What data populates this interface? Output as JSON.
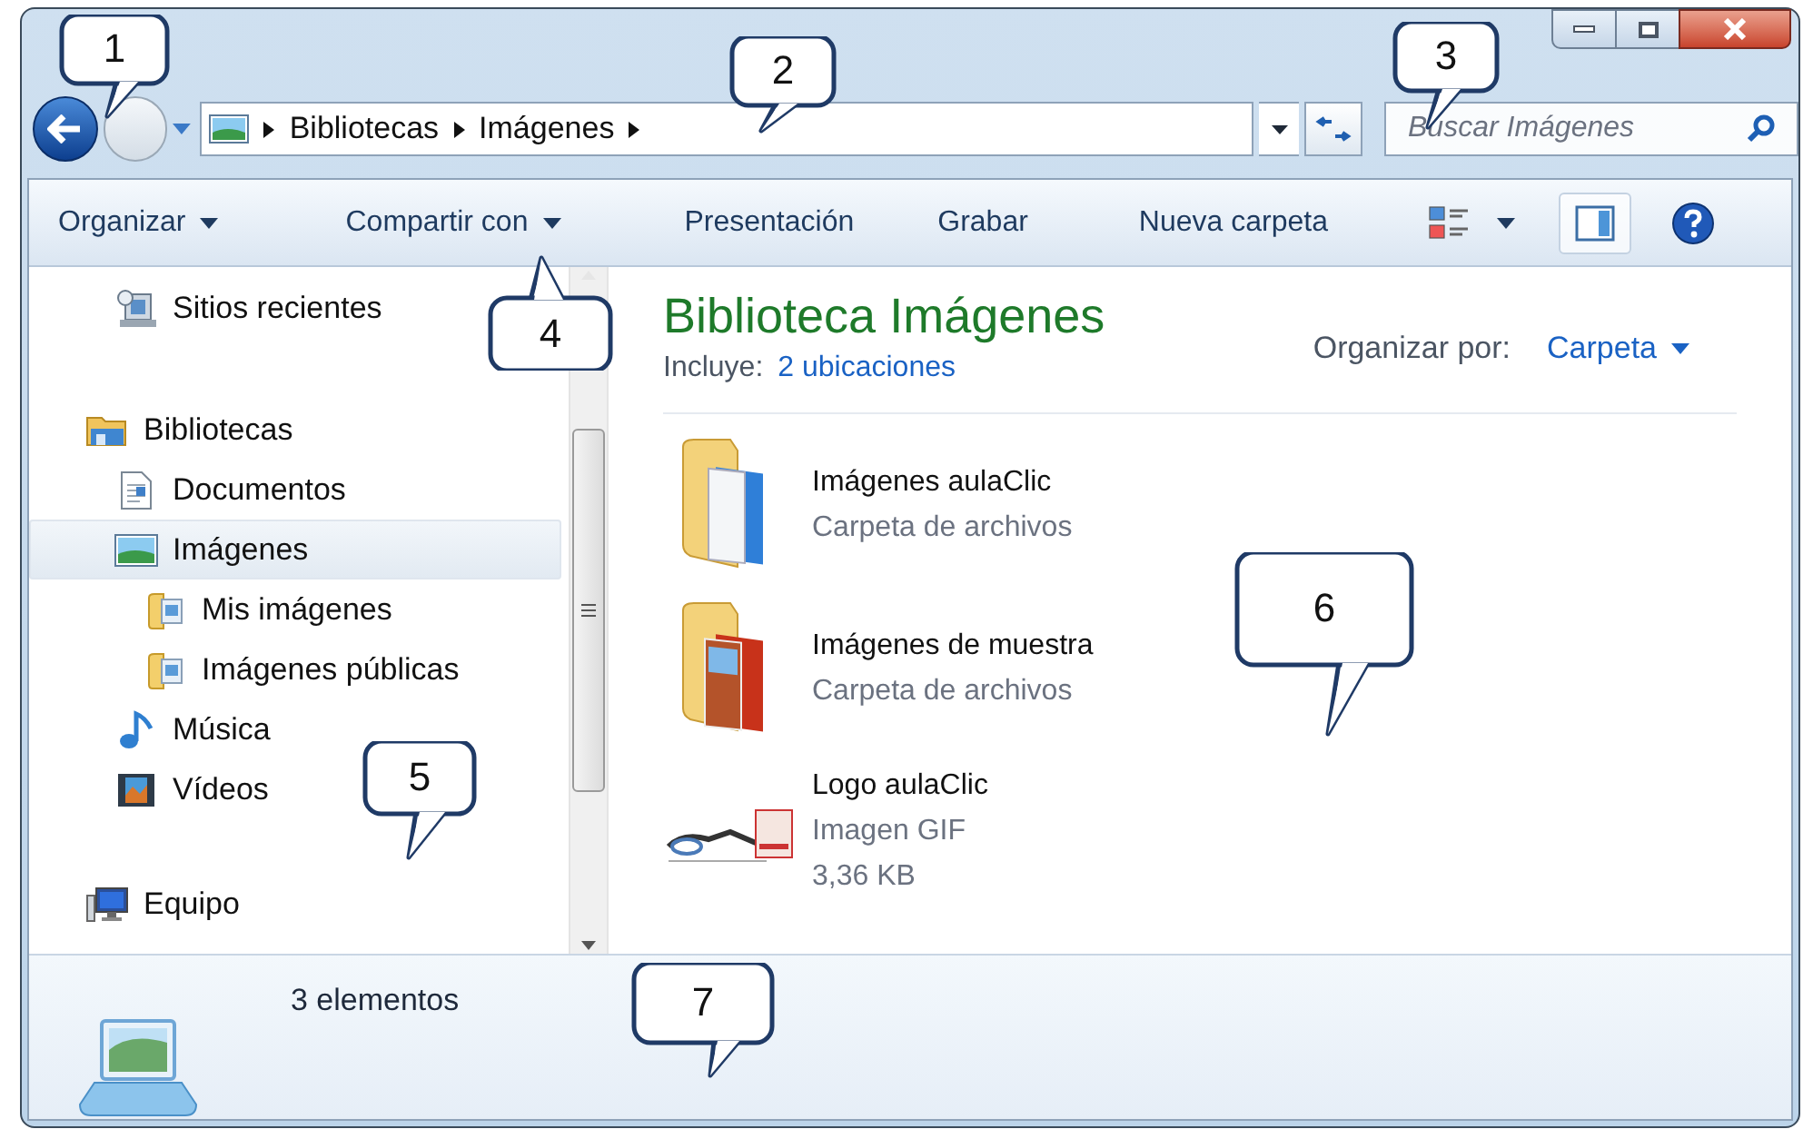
{
  "address_bar": {
    "crumbs": [
      "Bibliotecas",
      "Imágenes"
    ]
  },
  "search": {
    "placeholder": "Buscar Imágenes"
  },
  "toolbar": {
    "items": [
      {
        "label": "Organizar",
        "dropdown": true
      },
      {
        "label": "Compartir con",
        "dropdown": true
      },
      {
        "label": "Presentación",
        "dropdown": false
      },
      {
        "label": "Grabar",
        "dropdown": false
      },
      {
        "label": "Nueva carpeta",
        "dropdown": false
      }
    ]
  },
  "navigation": {
    "items": [
      {
        "label": "Sitios recientes",
        "kind": "recent",
        "selected": false
      },
      {
        "label": "Bibliotecas",
        "kind": "library",
        "selected": false,
        "children": [
          {
            "label": "Documentos",
            "kind": "document",
            "selected": false
          },
          {
            "label": "Imágenes",
            "kind": "pictures",
            "selected": true,
            "children": [
              {
                "label": "Mis imágenes",
                "kind": "folder",
                "selected": false
              },
              {
                "label": "Imágenes públicas",
                "kind": "folder",
                "selected": false
              }
            ]
          },
          {
            "label": "Música",
            "kind": "music",
            "selected": false
          },
          {
            "label": "Vídeos",
            "kind": "video",
            "selected": false
          }
        ]
      },
      {
        "label": "Equipo",
        "kind": "computer",
        "selected": false
      }
    ]
  },
  "library": {
    "title": "Biblioteca Imágenes",
    "includes_label": "Incluye:",
    "includes_link": "2 ubicaciones",
    "arrange_label": "Organizar por:",
    "arrange_value": "Carpeta"
  },
  "files": [
    {
      "name": "Imágenes aulaClic",
      "type": "Carpeta de archivos",
      "kind": "folder"
    },
    {
      "name": "Imágenes de muestra",
      "type": "Carpeta de archivos",
      "kind": "photo-folder"
    },
    {
      "name": "Logo aulaClic",
      "type": "Imagen GIF",
      "size": "3,36 KB",
      "kind": "image"
    }
  ],
  "status_bar": {
    "count": "3 elementos"
  },
  "callouts": [
    {
      "label": "1"
    },
    {
      "label": "2"
    },
    {
      "label": "3"
    },
    {
      "label": "4"
    },
    {
      "label": "5"
    },
    {
      "label": "6"
    },
    {
      "label": "7"
    }
  ]
}
